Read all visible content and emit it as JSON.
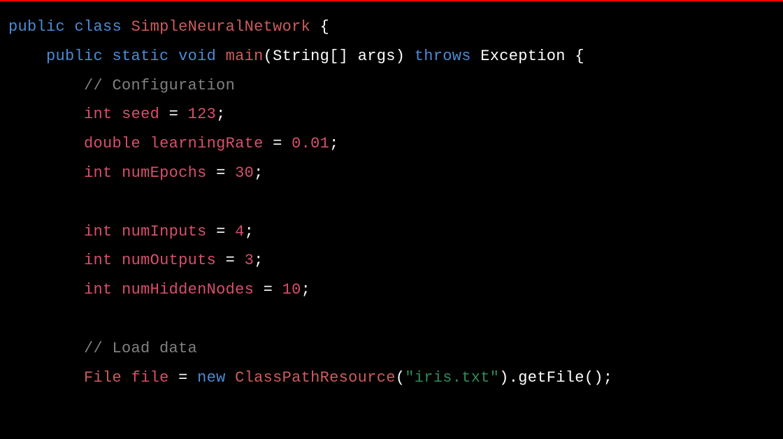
{
  "code": {
    "line1": {
      "public": "public",
      "class": "class",
      "className": "SimpleNeuralNetwork",
      "brace": "{"
    },
    "line2": {
      "public": "public",
      "static": "static",
      "void": "void",
      "main": "main",
      "paren1": "(",
      "stringArr": "String[]",
      "args": "args",
      "paren2": ")",
      "throws": "throws",
      "exception": "Exception",
      "brace": "{"
    },
    "line3": {
      "comment": "// Configuration"
    },
    "line4": {
      "int": "int",
      "var": "seed",
      "eq": "=",
      "num": "123",
      "semi": ";"
    },
    "line5": {
      "double": "double",
      "var": "learningRate",
      "eq": "=",
      "num": "0.01",
      "semi": ";"
    },
    "line6": {
      "int": "int",
      "var": "numEpochs",
      "eq": "=",
      "num": "30",
      "semi": ";"
    },
    "line8": {
      "int": "int",
      "var": "numInputs",
      "eq": "=",
      "num": "4",
      "semi": ";"
    },
    "line9": {
      "int": "int",
      "var": "numOutputs",
      "eq": "=",
      "num": "3",
      "semi": ";"
    },
    "line10": {
      "int": "int",
      "var": "numHiddenNodes",
      "eq": "=",
      "num": "10",
      "semi": ";"
    },
    "line12": {
      "comment": "// Load data"
    },
    "line13": {
      "fileType": "File",
      "var": "file",
      "eq": "=",
      "new": "new",
      "className": "ClassPathResource",
      "paren1": "(",
      "str": "\"iris.txt\"",
      "paren2": ")",
      "dot": ".",
      "method": "getFile",
      "paren3": "(",
      "paren4": ")",
      "semi": ";"
    }
  }
}
